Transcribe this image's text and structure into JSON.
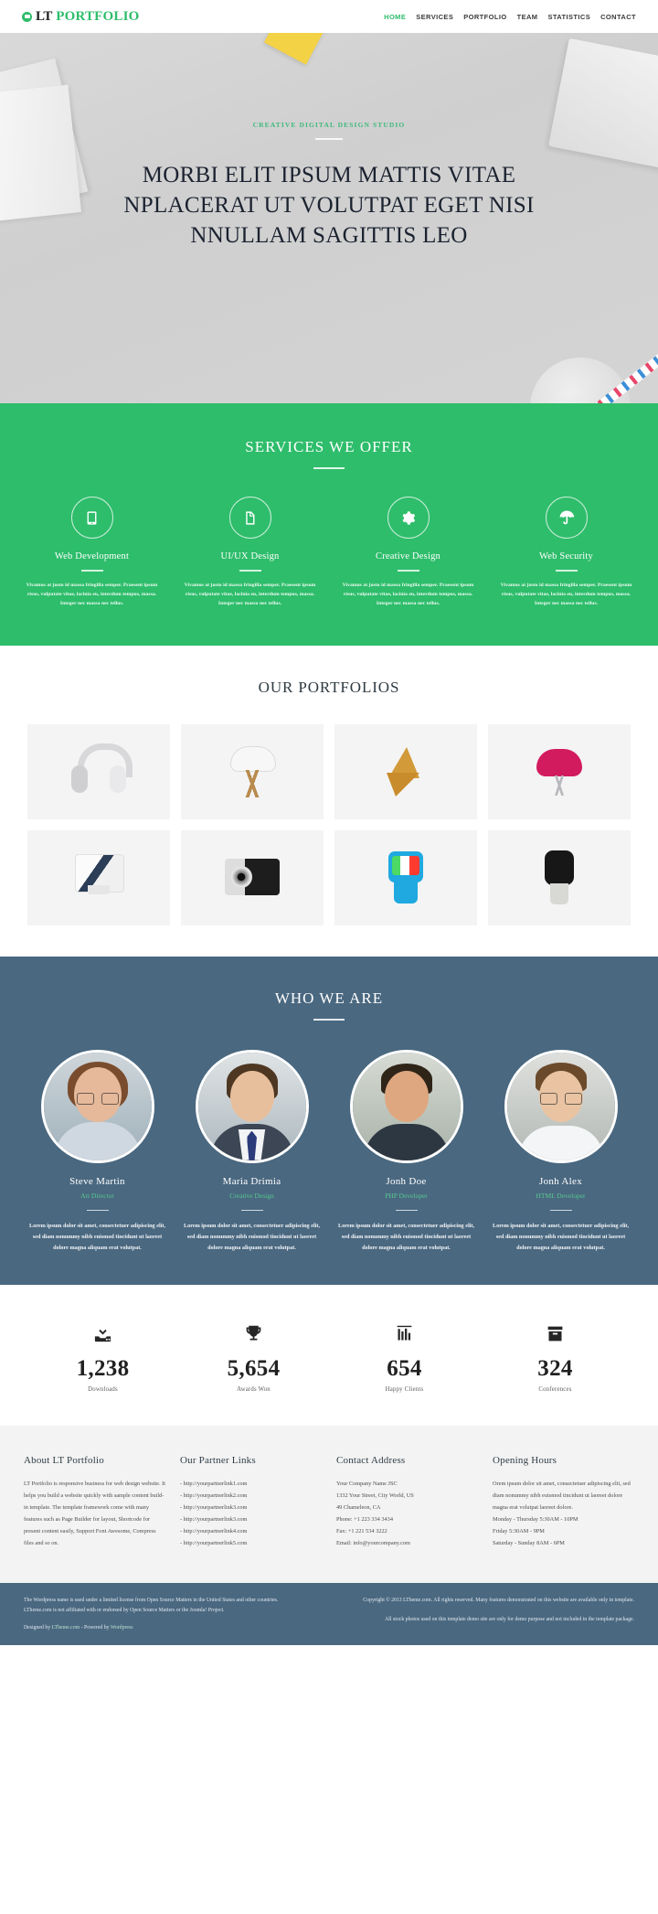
{
  "colors": {
    "green": "#2EBD6B",
    "slate": "#4A6880",
    "dark_text": "#212121",
    "role_green": "#57C98E"
  },
  "header": {
    "logo": {
      "icon": "circle-logo-icon",
      "primary": "LT",
      "secondary": "PORTFOLIO"
    },
    "nav": [
      {
        "label": "HOME",
        "active": true
      },
      {
        "label": "SERVICES",
        "active": false
      },
      {
        "label": "PORTFOLIO",
        "active": false
      },
      {
        "label": "TEAM",
        "active": false
      },
      {
        "label": "STATISTICS",
        "active": false
      },
      {
        "label": "CONTACT",
        "active": false
      }
    ]
  },
  "hero": {
    "kicker": "CREATIVE DIGITAL DESIGN STUDIO",
    "title_line1": "MORBI ELIT IPSUM MATTIS VITAE",
    "title_line2": "NPLACERAT UT VOLUTPAT EGET NISI",
    "title_line3": "NNULLAM SAGITTIS LEO"
  },
  "services": {
    "heading": "SERVICES WE OFFER",
    "items": [
      {
        "icon": "tablet-icon",
        "name": "Web Development",
        "desc": "Vivamus at justo id massa fringilla semper. Praesent ipsum risus, vulputate vitae, lacinia eu, interdum tempus, massa. Integer nec massa nec tellus."
      },
      {
        "icon": "file-icon",
        "name": "UI/UX Design",
        "desc": "Vivamus at justo id massa fringilla semper. Praesent ipsum risus, vulputate vitae, lacinia eu, interdum tempus, massa. Integer nec massa nec tellus."
      },
      {
        "icon": "gear-icon",
        "name": "Creative Design",
        "desc": "Vivamus at justo id massa fringilla semper. Praesent ipsum risus, vulputate vitae, lacinia eu, interdum tempus, massa. Integer nec massa nec tellus."
      },
      {
        "icon": "umbrella-icon",
        "name": "Web Security",
        "desc": "Vivamus at justo id massa fringilla semper. Praesent ipsum risus, vulputate vitae, lacinia eu, interdum tempus, massa. Integer nec massa nec tellus."
      }
    ]
  },
  "portfolio": {
    "heading": "OUR PORTFOLIOS",
    "items": [
      {
        "thumb": "headphones-thumb"
      },
      {
        "thumb": "white-chair-thumb"
      },
      {
        "thumb": "wood-origami-chair-thumb"
      },
      {
        "thumb": "pink-chair-thumb"
      },
      {
        "thumb": "printer-thumb"
      },
      {
        "thumb": "camera-thumb"
      },
      {
        "thumb": "blue-smartwatch-thumb"
      },
      {
        "thumb": "black-smartwatch-thumb"
      }
    ]
  },
  "team": {
    "heading": "WHO WE ARE",
    "members": [
      {
        "name": "Steve Martin",
        "role": "Art Director",
        "desc": "Lorem ipsum dolor sit amet, consectetuer adipiscing elit, sed diam nonummy nibh euismod tincidunt ut laoreet dolore magna aliquam erat volutpat."
      },
      {
        "name": "Maria Drimia",
        "role": "Creative Design",
        "desc": "Lorem ipsum dolor sit amet, consectetuer adipiscing elit, sed diam nonummy nibh euismod tincidunt ut laoreet dolore magna aliquam erat volutpat."
      },
      {
        "name": "Jonh Doe",
        "role": "PHP Developer",
        "desc": "Lorem ipsum dolor sit amet, consectetuer adipiscing elit, sed diam nonummy nibh euismod tincidunt ut laoreet dolore magna aliquam erat volutpat."
      },
      {
        "name": "Jonh Alex",
        "role": "HTML Developer",
        "desc": "Lorem ipsum dolor sit amet, consectetuer adipiscing elit, sed diam nonummy nibh euismod tincidunt ut laoreet dolore magna aliquam erat volutpat."
      }
    ]
  },
  "stats": [
    {
      "icon": "download-icon",
      "value": "1,238",
      "label": "Downloads"
    },
    {
      "icon": "trophy-icon",
      "value": "5,654",
      "label": "Awards Won"
    },
    {
      "icon": "bar-chart-icon",
      "value": "654",
      "label": "Happy Clients"
    },
    {
      "icon": "archive-icon",
      "value": "324",
      "label": "Conferences"
    }
  ],
  "footer": {
    "about": {
      "title": "About LT Portfolio",
      "body": "LT Portfolio is responsive business for web design website. It helps you build a website quickly with sample content build-in template. The template framework come with many features such as Page Builder for layout, Shortcode for present content easily, Support Font Awesome, Compress files and so on."
    },
    "partners": {
      "title": "Our Partner Links",
      "links": [
        "- http://yourpartnerlink1.com",
        "- http://yourpartnerlink2.com",
        "- http://yourpartnerlink3.com",
        "- http://yourpartnerlink3.com",
        "- http://yourpartnerlink4.com",
        "- http://yourpartnerlink5.com"
      ]
    },
    "contact": {
      "title": "Contact Address",
      "lines": [
        "Your Company Name JSC",
        "1332 Your Street, City World, US",
        "49 Chameleon, CA",
        "Phone: +1 223 334 3434",
        "Fax: +1 221 534 3222",
        "Email: info@yourcompany.com"
      ]
    },
    "hours": {
      "title": "Opening Hours",
      "body": "Orem ipsum dolor sit amet, consectetuer adipiscing elit, sed diam nonummy nibh euismod tincidunt ut laoreet dolore magna erat volutpat laoreet dolore.",
      "lines": [
        "Monday - Thursday 5:30AM - 10PM",
        "Friday 5:30AM - 9PM",
        "Saturday - Sunday 8AM - 6PM"
      ]
    },
    "bottom": {
      "license": "The Wordpress name is used under a limited license from Open Source Matters in the United States and other countries. LTheme.com is not affiliated with or endorsed by Open Source Matters or the Joomla! Project.",
      "credit_prefix": "Designed by",
      "credit_link": "LTheme.com",
      "credit_mid": " - Powered by ",
      "credit_suffix": "Wordpress",
      "copyright": "Copyright © 2013 LTheme.com. All rights reserved. Many features demonstrated on this website are available only in template.",
      "photos": "All stock photos used on this template demo site are only for demo purpose and not included in the template package."
    }
  }
}
